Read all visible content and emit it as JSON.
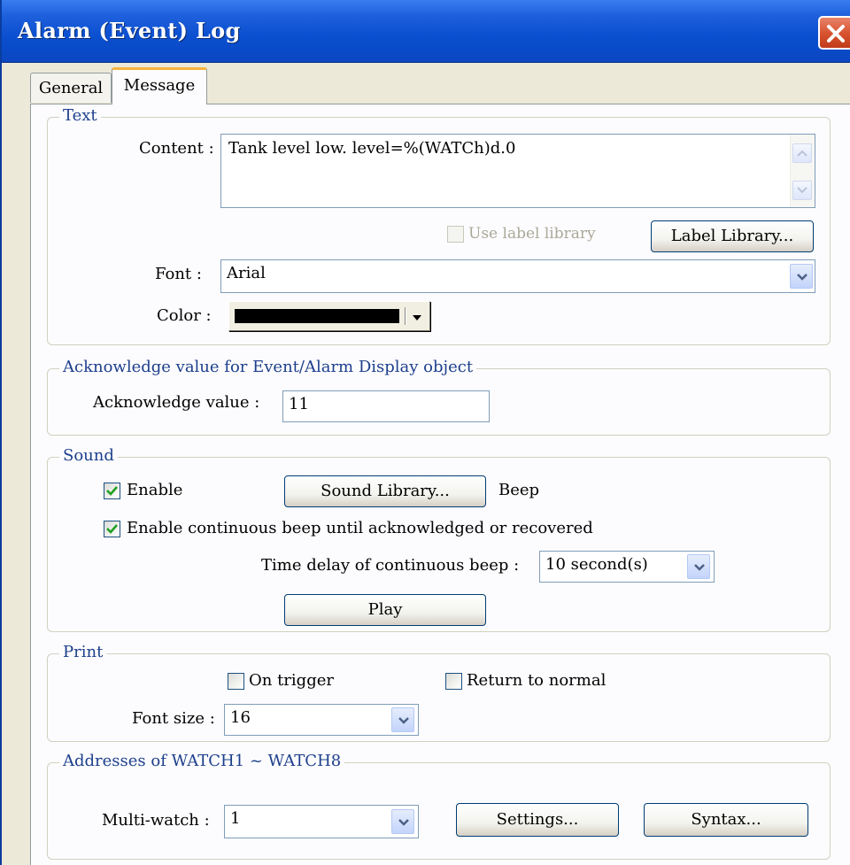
{
  "window": {
    "title": "Alarm (Event) Log"
  },
  "tabs": [
    {
      "label": "General",
      "active": false
    },
    {
      "label": "Message",
      "active": true
    }
  ],
  "text_group": {
    "legend": "Text",
    "content_label": "Content :",
    "content_value": "Tank level low. level=%(WATCh)d.0",
    "use_label_library": "Use label library",
    "use_label_library_checked": false,
    "label_library_button": "Label Library...",
    "font_label": "Font :",
    "font_value": "Arial",
    "color_label": "Color :",
    "color_value": "#000000"
  },
  "ack_group": {
    "legend": "Acknowledge value for Event/Alarm Display object",
    "ack_label": "Acknowledge  value :",
    "ack_value": "11"
  },
  "sound_group": {
    "legend": "Sound",
    "enable_label": "Enable",
    "enable_checked": true,
    "sound_library_button": "Sound Library...",
    "sound_name": "Beep",
    "continuous_label": "Enable continuous beep until acknowledged or recovered",
    "continuous_checked": true,
    "delay_label": "Time delay of continuous beep :",
    "delay_value": "10  second(s)",
    "play_button": "Play"
  },
  "print_group": {
    "legend": "Print",
    "on_trigger_label": "On trigger",
    "on_trigger_checked": false,
    "return_normal_label": "Return to normal",
    "return_normal_checked": false,
    "font_size_label": "Font size :",
    "font_size_value": "16"
  },
  "watch_group": {
    "legend": "Addresses of WATCH1 ~ WATCH8",
    "multiwatch_label": "Multi-watch :",
    "multiwatch_value": "1",
    "settings_button": "Settings...",
    "syntax_button": "Syntax..."
  },
  "icons": {
    "close": "close-x-icon",
    "dropdown": "chevron-down-icon",
    "check": "checkmark-icon",
    "scroll_up": "scroll-up-arrow-icon",
    "scroll_down": "scroll-down-arrow-icon"
  },
  "colors": {
    "title_bar": "#0a4fd0",
    "legend_text": "#1d3f8c",
    "checkmark": "#21a121",
    "close_button": "#d6512d"
  }
}
